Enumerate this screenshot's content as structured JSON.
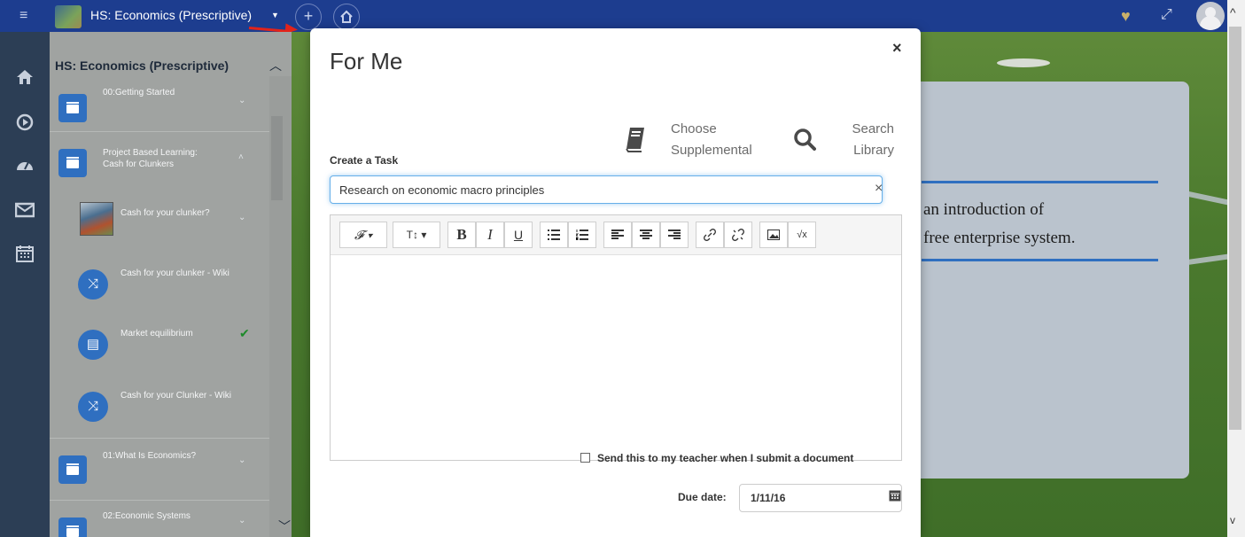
{
  "topbar": {
    "course_title": "HS: Economics (Prescriptive)",
    "menu_icon": "hamburger-icon",
    "add_icon": "plus-icon",
    "home_icon": "home-icon",
    "favorite_icon": "heart-icon",
    "fullscreen_icon": "expand-icon"
  },
  "rail": {
    "items": [
      "home-icon",
      "play-icon",
      "dashboard-icon",
      "mail-icon",
      "calendar-icon"
    ]
  },
  "sidebar": {
    "header": "HS: Economics (Prescriptive)",
    "items": [
      {
        "label": "00:Getting Started",
        "type": "unit"
      },
      {
        "label": "Project Based Learning: Cash for Clunkers",
        "type": "unit-open"
      },
      {
        "label": "Cash for your clunker?",
        "type": "image"
      },
      {
        "label": "Cash for your clunker - Wiki",
        "type": "wiki"
      },
      {
        "label": "Market equilibrium",
        "type": "doc",
        "completed": true
      },
      {
        "label": "Cash for your Clunker - Wiki",
        "type": "wiki"
      },
      {
        "label": "01:What Is Economics?",
        "type": "unit"
      },
      {
        "label": "02:Economic Systems",
        "type": "unit"
      }
    ]
  },
  "content": {
    "text_line1": "an introduction of",
    "text_line2": "free enterprise system."
  },
  "modal": {
    "title": "For Me",
    "close": "×",
    "create_label": "Create a Task",
    "choose_label": "Choose Supplemental",
    "search_label": "Search Library",
    "task_value": "Research on economic macro principles",
    "clear": "×",
    "toolbar": [
      "font",
      "text-size",
      "bold",
      "italic",
      "underline",
      "bullet-list",
      "numbered-list",
      "align-left",
      "align-center",
      "align-right",
      "link",
      "unlink",
      "image",
      "formula"
    ],
    "toolbar_labels": {
      "font": "𝓕 ▾",
      "size": "T↕ ▾",
      "bold": "B",
      "italic": "I",
      "underline": "U",
      "formula": "√x"
    },
    "send_label": "Send this to my teacher when I submit a document",
    "send_checked": false,
    "due_label": "Due date:",
    "due_value": "1/11/16"
  },
  "colors": {
    "topbar": "#1d3d8f",
    "rail": "#2c3e55",
    "accent": "#2f6fc0",
    "annotation_arrow": "#e2231a"
  }
}
